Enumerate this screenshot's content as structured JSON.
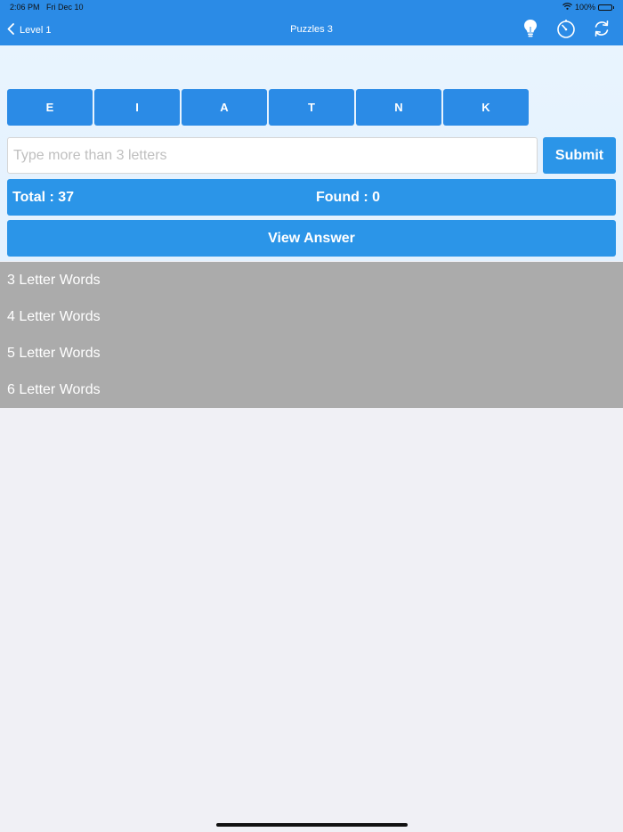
{
  "status_bar": {
    "time": "2:06 PM",
    "date": "Fri Dec 10",
    "battery": "100%"
  },
  "nav": {
    "back_label": "Level 1",
    "title": "Puzzles 3",
    "icons": [
      "bulb-icon",
      "timer-icon",
      "refresh-icon"
    ]
  },
  "letters": [
    "E",
    "I",
    "A",
    "T",
    "N",
    "K"
  ],
  "input": {
    "value": "",
    "placeholder": "Type more than 3 letters"
  },
  "submit_label": "Submit",
  "stats": {
    "total": "Total : 37",
    "found": "Found : 0"
  },
  "view_answer_label": "View Answer",
  "word_groups": [
    "3 Letter Words",
    "4 Letter Words",
    "5 Letter Words",
    "6 Letter Words"
  ],
  "colors": {
    "accent": "#2b8be6",
    "button": "#2b95e8",
    "list_bg": "#ababab",
    "header_bg": "#e9f4fe"
  }
}
